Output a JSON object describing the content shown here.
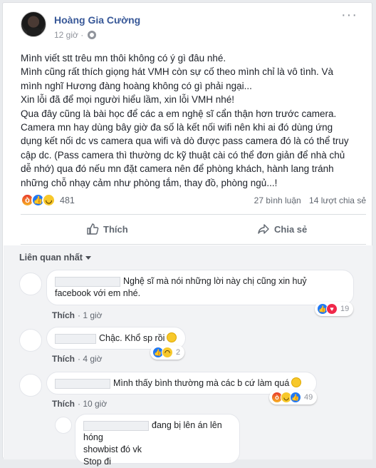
{
  "post": {
    "author": "Hoàng Gia Cường",
    "time": "12 giờ ·",
    "more": "···",
    "lines": [
      "Mình viết stt trêu mn thôi không có ý gì đâu nhé.",
      "Mình cũng rất thích giọng hát VMH còn sự cố theo mình chỉ là vô tình. Và",
      "mình nghĩ Hương đàng hoàng không có gì phải ngại...",
      "Xin lỗi đã để mọi người hiểu lầm, xin lỗi VMH nhé!",
      "Qua đây cũng là bài học để các a em nghệ sĩ cẩn thận hơn trước camera.",
      "Camera mn hay dùng bây giờ đa số là kết nối wifi nên khi ai đó dùng ứng",
      "dụng kết nối dc vs camera qua wifi và dò được pass camera đó là có thể truy",
      "cập dc. (Pass camera thì thường dc kỹ thuật cài có thể đơn giản để nhà chủ",
      "dễ nhớ) qua đó nếu mn đặt camera nên để phòng khách, hành lang tránh",
      "những chỗ nhạy cảm như phòng tắm, thay đồ, phòng ngủ...!"
    ]
  },
  "stats": {
    "reaction_count": "481",
    "comments": "27 bình luận",
    "shares": "14 lượt chia sẻ"
  },
  "actions": {
    "like": "Thích",
    "share": "Chia sẻ"
  },
  "comments_sort": "Liên quan nhất",
  "comments": [
    {
      "text": "Nghệ sĩ mà nói những lời này chị cũng xin huỷ",
      "text2": "facebook với em nhé.",
      "like": "Thích",
      "time": "· 1 giờ",
      "reactions": "19"
    },
    {
      "text": "Chậc. Khổ sp rồi",
      "like": "Thích",
      "time": "· 4 giờ",
      "reactions": "2"
    },
    {
      "text": "Mình thấy bình thường mà các b cứ làm quá",
      "like": "Thích",
      "time": "· 10 giờ",
      "reactions": "49"
    },
    {
      "text": "đang bị lên án lên hóng",
      "text2": "showbist đó vk",
      "text3": "Stop đi"
    }
  ]
}
